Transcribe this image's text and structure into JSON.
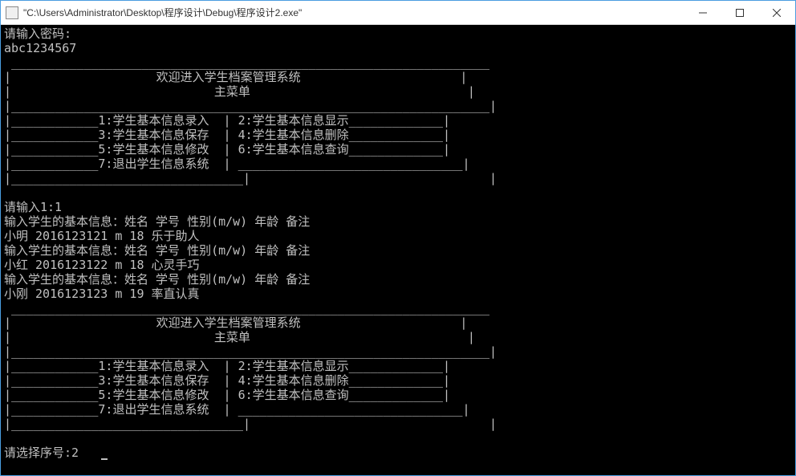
{
  "titlebar": {
    "text": "\"C:\\Users\\Administrator\\Desktop\\程序设计\\Debug\\程序设计2.exe\""
  },
  "console": {
    "prompt_password": "请输入密码:",
    "password_input": "abc1234567",
    "menu": {
      "title": "欢迎进入学生档案管理系统",
      "subtitle": "主菜单",
      "items": {
        "1": "1:学生基本信息录入",
        "2": "2:学生基本信息显示",
        "3": "3:学生基本信息保存",
        "4": "4:学生基本信息删除",
        "5": "5:学生基本信息修改",
        "6": "6:学生基本信息查询",
        "7": "7:退出学生信息系统"
      }
    },
    "input_1": "请输入1:1",
    "entry_prompt": "输入学生的基本信息：姓名 学号 性别(m/w) 年龄 备注",
    "records": [
      "小明 2016123121 m 18 乐于助人",
      "小红 2016123122 m 18 心灵手巧",
      "小刚 2016123123 m 19 率直认真"
    ],
    "select_prompt": "请选择序号:",
    "select_value": "2"
  }
}
